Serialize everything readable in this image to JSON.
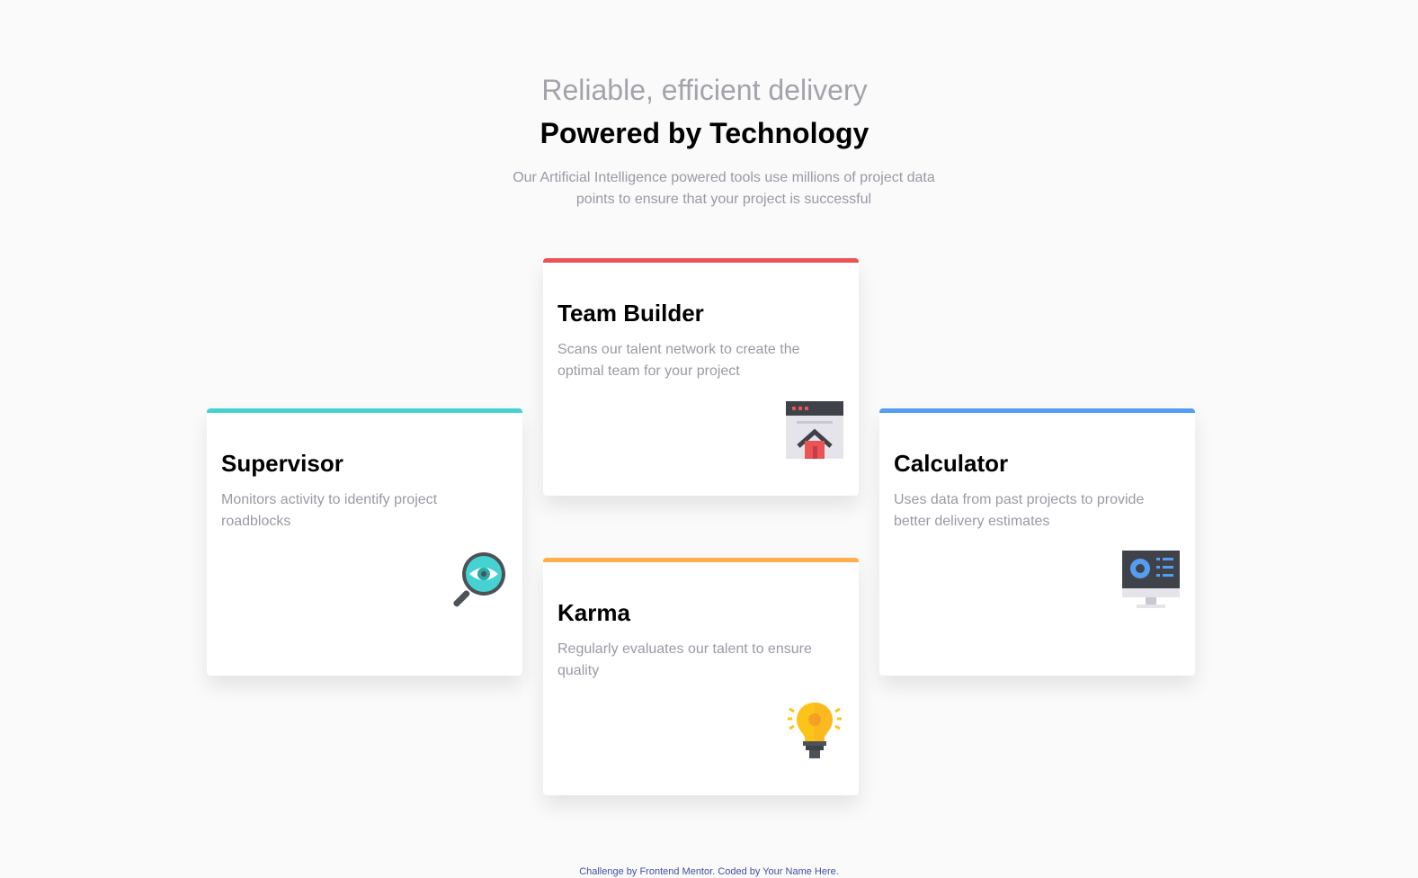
{
  "header": {
    "subtitle": "Reliable, efficient delivery",
    "title": "Powered by Technology",
    "intro": "Our Artificial Intelligence powered tools use millions of project data points to ensure that your project is successful"
  },
  "cards": {
    "supervisor": {
      "title": "Supervisor",
      "description": "Monitors activity to identify project roadblocks",
      "accent": "#44d3d2",
      "icon": "supervisor-icon"
    },
    "team_builder": {
      "title": "Team Builder",
      "description": "Scans our talent network to create the optimal team for your project",
      "accent": "#ea5454",
      "icon": "team-builder-icon"
    },
    "karma": {
      "title": "Karma",
      "description": "Regularly evaluates our talent to ensure quality",
      "accent": "#fcaf4a",
      "icon": "karma-icon"
    },
    "calculator": {
      "title": "Calculator",
      "description": "Uses data from past projects to provide better delivery estimates",
      "accent": "#549ef2",
      "icon": "calculator-icon"
    }
  },
  "footer": {
    "attribution": "Challenge by Frontend Mentor. Coded by Your Name Here."
  }
}
